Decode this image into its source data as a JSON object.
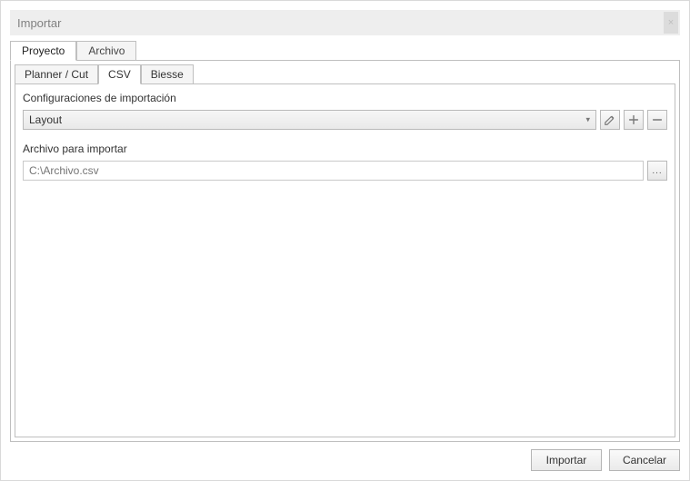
{
  "window": {
    "title": "Importar",
    "close_glyph": "×"
  },
  "tabs": {
    "primary": [
      {
        "label": "Proyecto",
        "active": true
      },
      {
        "label": "Archivo",
        "active": false
      }
    ],
    "secondary": [
      {
        "label": "Planner / Cut",
        "active": false
      },
      {
        "label": "CSV",
        "active": true
      },
      {
        "label": "Biesse",
        "active": false
      }
    ]
  },
  "form": {
    "config_label": "Configuraciones de importación",
    "config_value": "Layout",
    "file_label": "Archivo para importar",
    "file_placeholder": "C:\\Archivo.csv",
    "browse_glyph": "..."
  },
  "icons": {
    "edit": "edit-icon",
    "add": "plus-icon",
    "remove": "minus-icon"
  },
  "footer": {
    "import_label": "Importar",
    "cancel_label": "Cancelar"
  }
}
